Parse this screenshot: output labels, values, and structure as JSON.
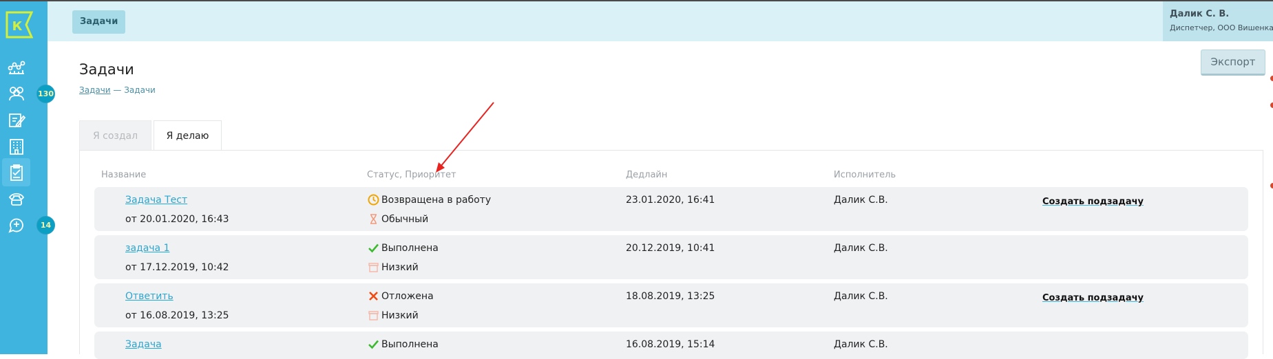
{
  "header": {
    "tab_label": "Задачи",
    "user": {
      "name": "Далик С. В.",
      "role": "Диспетчер, ООО Вишенка"
    },
    "export_label": "Экспорт"
  },
  "sidebar": {
    "logo_letter": "К",
    "items": [
      {
        "icon": "analytics-icon"
      },
      {
        "icon": "users-icon",
        "badge": "130"
      },
      {
        "icon": "edit-icon"
      },
      {
        "icon": "building-icon"
      },
      {
        "icon": "clipboard-icon",
        "active": true
      },
      {
        "icon": "phone-icon"
      },
      {
        "icon": "chat-add-icon",
        "badge": "14"
      }
    ]
  },
  "page": {
    "title": "Задачи",
    "breadcrumb": {
      "link": "Задачи",
      "separator": " — ",
      "current": "Задачи"
    }
  },
  "tabs": [
    {
      "label": "Я создал",
      "active": false
    },
    {
      "label": "Я делаю",
      "active": true
    }
  ],
  "table": {
    "columns": [
      "Название",
      "Статус, Приоритет",
      "Дедлайн",
      "Исполнитель"
    ],
    "rows": [
      {
        "name": "Задача Тест",
        "created": "от 20.01.2020, 16:43",
        "status": "Возвращена в работу",
        "status_icon": "clock-icon",
        "priority": "Обычный",
        "priority_icon": "hourglass-icon",
        "deadline": "23.01.2020, 16:41",
        "assignee": "Далик С.В.",
        "action": "Создать подзадачу"
      },
      {
        "name": "задача 1",
        "created": "от 17.12.2019, 10:42",
        "status": "Выполнена",
        "status_icon": "check-icon",
        "priority": "Низкий",
        "priority_icon": "box-icon",
        "deadline": "20.12.2019, 10:41",
        "assignee": "Далик С.В.",
        "action": ""
      },
      {
        "name": "Ответить",
        "created": "от 16.08.2019, 13:25",
        "status": "Отложена",
        "status_icon": "cross-icon",
        "priority": "Низкий",
        "priority_icon": "box-icon",
        "deadline": "18.08.2019, 13:25",
        "assignee": "Далик С.В.",
        "action": "Создать подзадачу"
      },
      {
        "name": "Задача",
        "created": "",
        "status": "Выполнена",
        "status_icon": "check-icon",
        "priority": "",
        "priority_icon": "",
        "deadline": "16.08.2019, 15:14",
        "assignee": "Далик С.В.",
        "action": ""
      }
    ]
  },
  "colors": {
    "sidebar": "#3fb4de",
    "header": "#d9f1f7",
    "link": "#2aa6d0",
    "badge": "#0b9fc4",
    "annotation_arrow": "#e8231f"
  }
}
